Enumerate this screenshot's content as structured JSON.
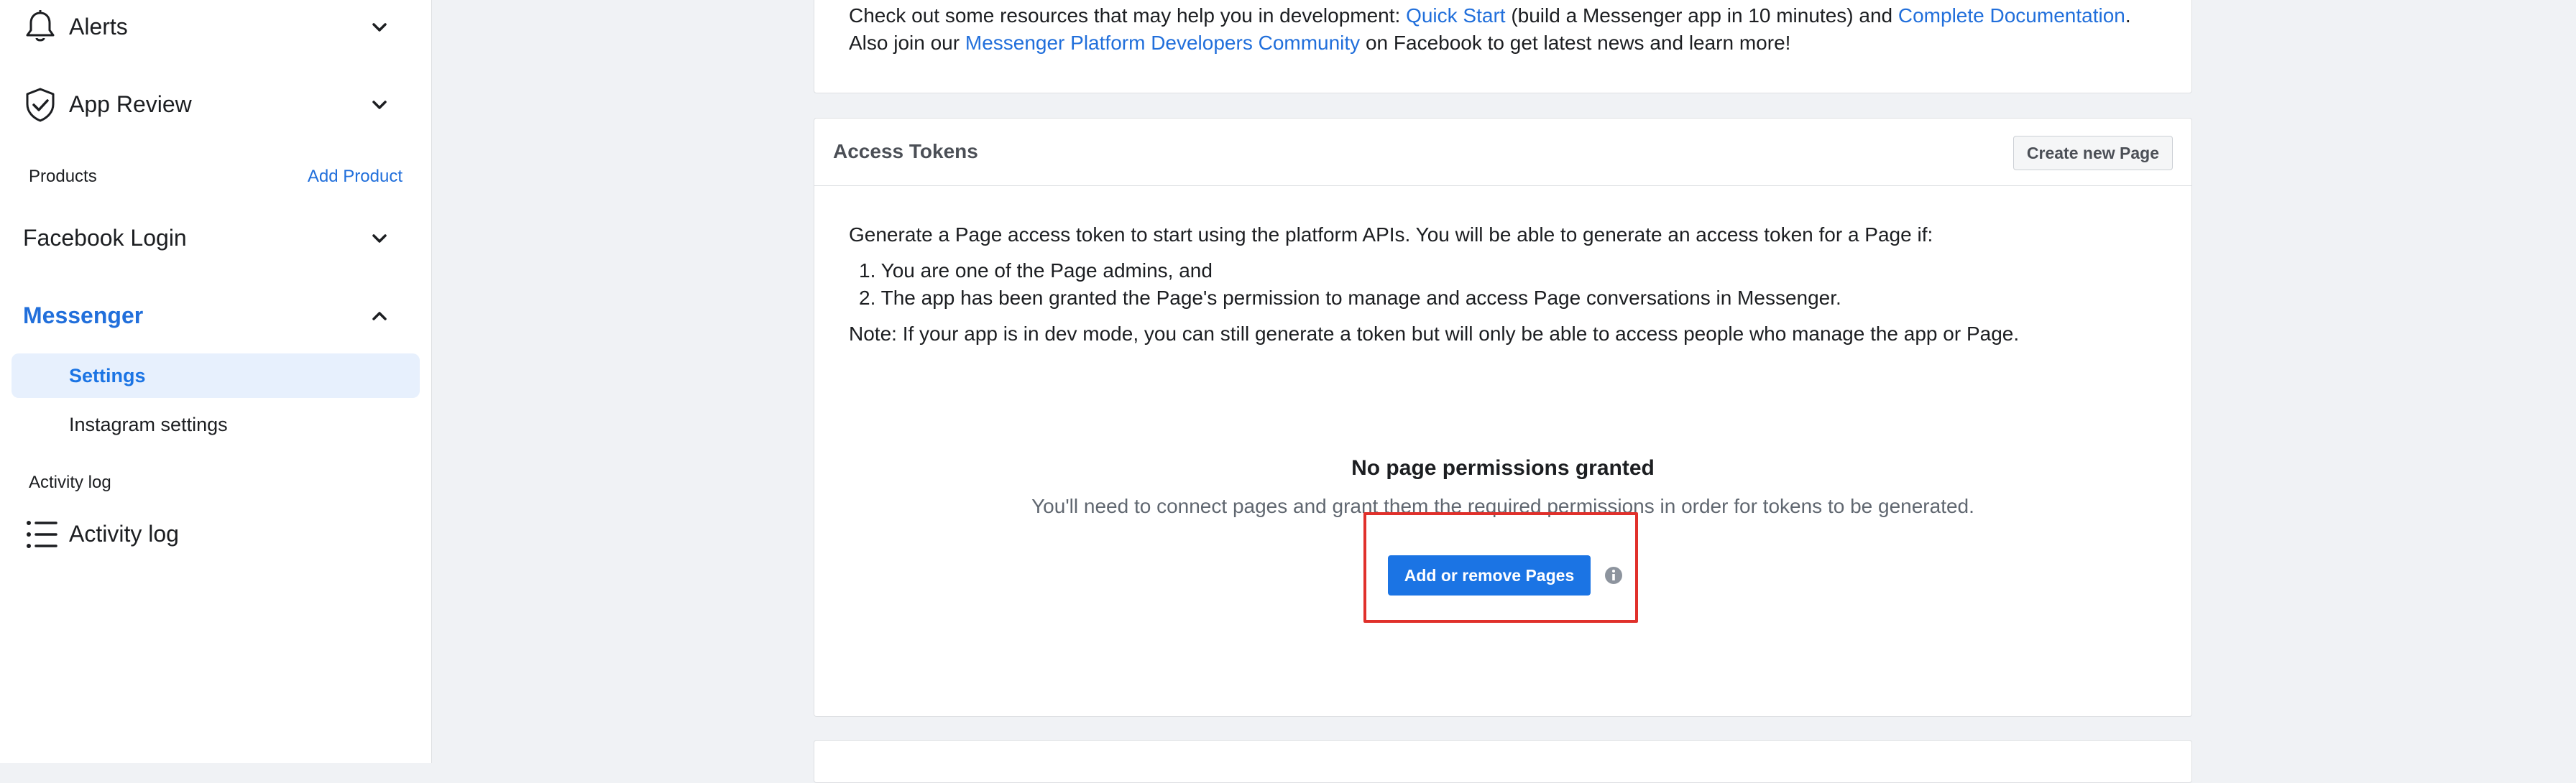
{
  "sidebar": {
    "alerts_label": "Alerts",
    "app_review_label": "App Review",
    "products_section_label": "Products",
    "add_product_label": "Add Product",
    "facebook_login_label": "Facebook Login",
    "messenger_label": "Messenger",
    "messenger_items": [
      {
        "label": "Settings",
        "active": true
      },
      {
        "label": "Instagram settings",
        "active": false
      }
    ],
    "activity_section_label": "Activity log",
    "activity_log_label": "Activity log"
  },
  "resources": {
    "text_before": "Check out some resources that may help you in development: ",
    "link_quick_start": "Quick Start",
    "text_middle": " (build a Messenger app in 10 minutes) and ",
    "link_complete_docs": "Complete Documentation",
    "text_after_docs": ". Also join our ",
    "link_community": "Messenger Platform Developers Community",
    "text_end": " on Facebook to get latest news and learn more!"
  },
  "access_tokens": {
    "title": "Access Tokens",
    "create_page_button": "Create new Page",
    "intro": "Generate a Page access token to start using the platform APIs. You will be able to generate an access token for a Page if:",
    "conditions": [
      "1. You are one of the Page admins, and",
      "2. The app has been granted the Page's permission to manage and access Page conversations in Messenger."
    ],
    "note": "Note: If your app is in dev mode, you can still generate a token but will only be able to access people who manage the app or Page.",
    "empty_title": "No page permissions granted",
    "empty_subtitle": "You'll need to connect pages and grant them the required permissions in order for tokens to be generated.",
    "add_pages_button": "Add or remove Pages"
  },
  "colors": {
    "accent": "#1b74e4",
    "link": "#216fdb",
    "highlight": "#e0302b"
  },
  "icons": {
    "alerts": "bell-icon",
    "app_review": "shield-check-icon",
    "activity_log": "list-icon",
    "info": "info-icon"
  }
}
